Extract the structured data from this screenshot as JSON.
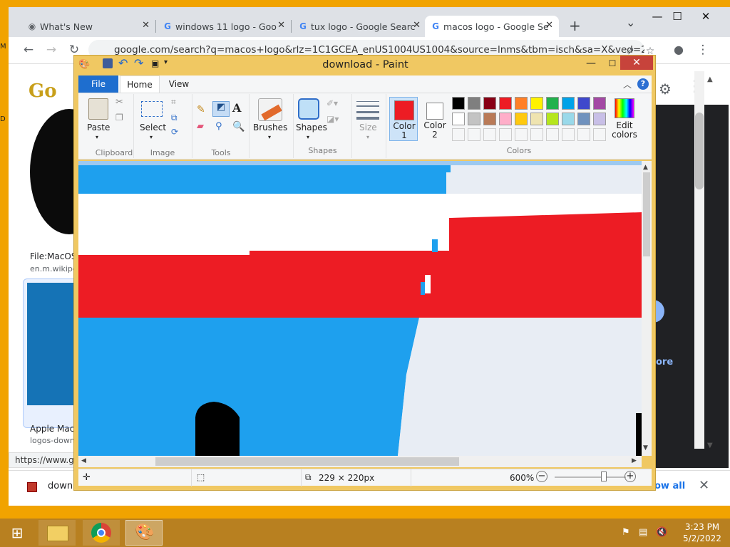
{
  "chrome": {
    "tabs": [
      {
        "title": "What's New",
        "icon": "chrome-icon"
      },
      {
        "title": "windows 11 logo - Goo",
        "icon": "google-icon"
      },
      {
        "title": "tux logo - Google Searc",
        "icon": "google-icon"
      },
      {
        "title": "macos logo - Google Se",
        "icon": "google-icon"
      }
    ],
    "new_tab": "+",
    "tab_menu": "⌄",
    "window_controls": {
      "minimize": "—",
      "maximize": "☐",
      "close": "✕"
    },
    "address": "google.com/search?q=macos+logo&rlz=1C1GCEA_enUS1004US1004&source=lnms&tbm=isch&sa=X&ved=2a...",
    "status_url": "https://www.go",
    "download_item": "downl",
    "show_all": "ow all"
  },
  "google": {
    "logo": "Go",
    "result1": {
      "caption": "File:MacOS",
      "source": "en.m.wikipe"
    },
    "result2": {
      "caption": "Apple Mac",
      "source": "logos-down"
    },
    "more_link": "ore"
  },
  "paint": {
    "title": "download - Paint",
    "tabs": {
      "file": "File",
      "home": "Home",
      "view": "View"
    },
    "groups": {
      "clipboard": {
        "label": "Clipboard",
        "paste": "Paste"
      },
      "image": {
        "label": "Image",
        "select": "Select"
      },
      "tools": {
        "label": "Tools"
      },
      "brushes": {
        "label": "Brushes"
      },
      "shapes": {
        "label": "Shapes",
        "shapes_btn": "Shapes"
      },
      "size": {
        "label": "Size"
      },
      "colors": {
        "label": "Colors",
        "color1": "Color\n1",
        "color2": "Color\n2",
        "edit": "Edit colors"
      }
    },
    "palette_row1": [
      "#000000",
      "#7f7f7f",
      "#880015",
      "#ed1c24",
      "#ff7f27",
      "#fff200",
      "#22b14c",
      "#00a2e8",
      "#3f48cc",
      "#a349a4"
    ],
    "palette_row2": [
      "#ffffff",
      "#c3c3c3",
      "#b97a57",
      "#ffaec9",
      "#ffc90e",
      "#efe4b0",
      "#b5e61d",
      "#99d9ea",
      "#7092be",
      "#c8bfe7"
    ],
    "color1": "#ed1c24",
    "color2": "#ffffff",
    "status": {
      "dimensions": "229 × 220px",
      "zoom": "600%"
    }
  },
  "taskbar": {
    "time": "3:23 PM",
    "date": "5/2/2022"
  }
}
